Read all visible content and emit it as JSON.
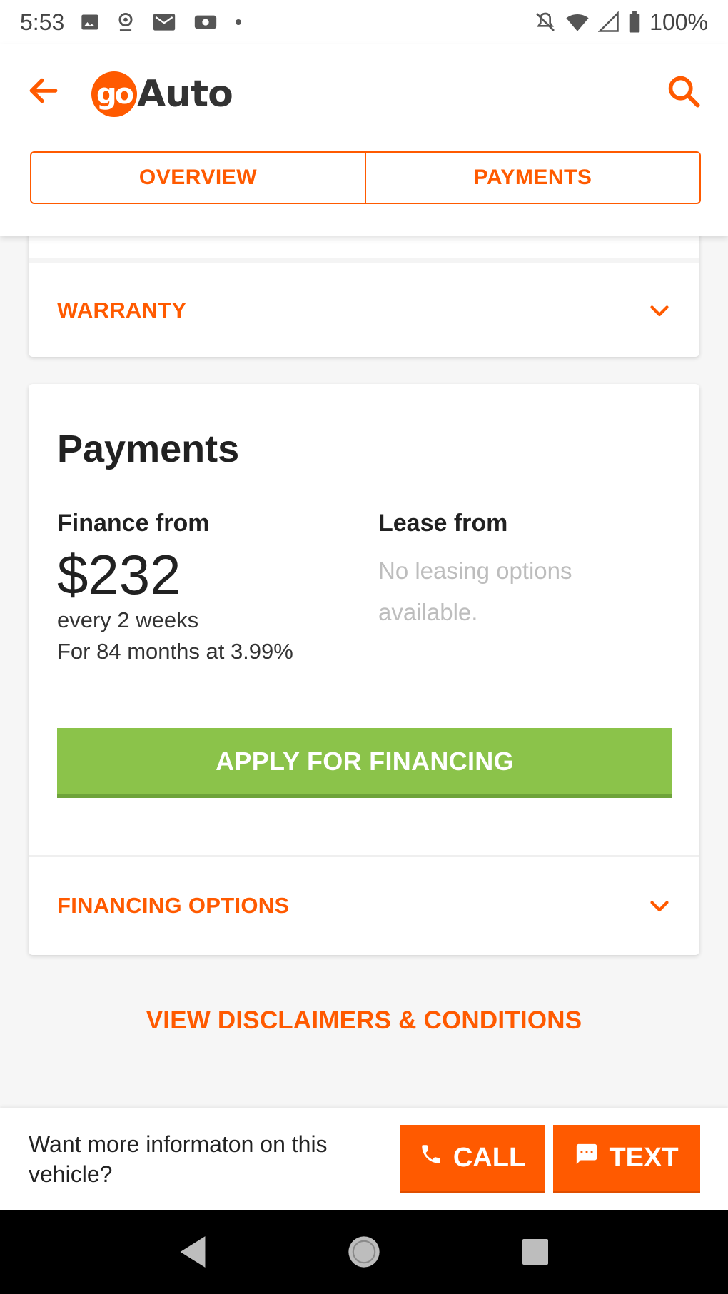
{
  "status_bar": {
    "time": "5:53",
    "battery": "100%",
    "icons": [
      "image-icon",
      "location-icon",
      "gmail-icon",
      "weather-icon",
      "dot-icon",
      "mute-icon",
      "wifi-icon",
      "signal-icon",
      "battery-icon"
    ]
  },
  "app_bar": {
    "logo_go": "go",
    "logo_text": "Auto",
    "tabs": [
      {
        "label": "OVERVIEW"
      },
      {
        "label": "PAYMENTS"
      }
    ]
  },
  "warranty": {
    "label": "WARRANTY"
  },
  "payments": {
    "title": "Payments",
    "finance": {
      "heading": "Finance from",
      "amount": "$232",
      "frequency": "every 2 weeks",
      "term": "For 84 months at 3.99%"
    },
    "lease": {
      "heading": "Lease from",
      "message": "No leasing options available."
    },
    "apply_button": "APPLY FOR FINANCING",
    "financing_options": "FINANCING OPTIONS"
  },
  "disclaimers_link": "VIEW DISCLAIMERS & CONDITIONS",
  "contact_bar": {
    "text": "Want more informaton on this vehicle?",
    "call_label": "CALL",
    "text_label": "TEXT"
  },
  "colors": {
    "accent": "#ff5a00",
    "apply_green": "#8bc34a",
    "muted_text": "#bdbdbd"
  }
}
